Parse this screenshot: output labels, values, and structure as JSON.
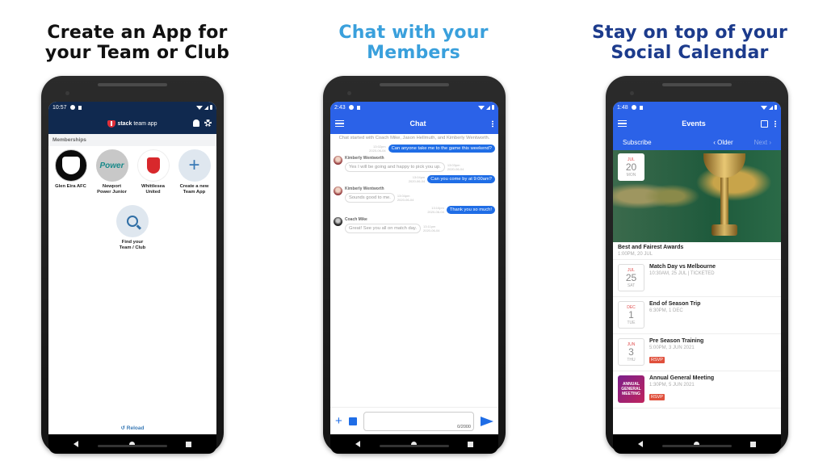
{
  "panels": [
    {
      "headline": [
        "Create an App for",
        "your Team or Club"
      ],
      "headline_color": "#111111",
      "status_time": "10:57",
      "appbar": {
        "logo_bold": "stack",
        "logo_text": "team app"
      },
      "section_title": "Memberships",
      "tiles": [
        {
          "label_lines": [
            "Glen Eira AFC"
          ]
        },
        {
          "label_lines": [
            "Newport",
            "Power Junior"
          ]
        },
        {
          "label_lines": [
            "Whittlesea",
            "United"
          ]
        },
        {
          "label_lines": [
            "Create a new",
            "Team App"
          ],
          "icon": "+"
        }
      ],
      "find_tile": {
        "label_lines": [
          "Find your",
          "Team / Club"
        ]
      },
      "reload_label": "↺ Reload",
      "colors": {
        "appbar": "#10294f",
        "accent": "#3a7ab6"
      }
    },
    {
      "headline": [
        "Chat with your",
        "Members"
      ],
      "headline_color": "#3aa0dc",
      "status_time": "2:43",
      "appbar_title": "Chat",
      "intro": "Chat started with Coach Mike, Jason Hellmuth, and Kimberly Wentworth.",
      "messages": [
        {
          "direction": "out",
          "text": "Can anyone take me to the game this weekend?",
          "time": "13:02pm",
          "date": "2020-06-04"
        },
        {
          "direction": "in",
          "sender": "Kimberly Wentworth",
          "avatar": "kimberly-avatar",
          "text": "Yes I will be going and happy to pick you up.",
          "time": "13:03pm",
          "date": "2020-06-04"
        },
        {
          "direction": "out",
          "text": "Can you come by at 9:00am?",
          "time": "13:04pm",
          "date": "2020-06-04"
        },
        {
          "direction": "in",
          "sender": "Kimberly Wentworth",
          "avatar": "kimberly-avatar",
          "text": "Sounds good to me.",
          "time": "13:04pm",
          "date": "2020-06-04"
        },
        {
          "direction": "out",
          "text": "Thank you so much!",
          "time": "13:10pm",
          "date": "2020-06-04"
        },
        {
          "direction": "in",
          "sender": "Coach Mike",
          "avatar": "coach-mike-avatar",
          "text": "Great! See you all on match day.",
          "time": "13:11pm",
          "date": "2020-06-04"
        }
      ],
      "composer": {
        "counter": "0/2000",
        "placeholder": ""
      },
      "colors": {
        "appbar": "#2b62e8",
        "bubble_out": "#1f6de6"
      }
    },
    {
      "headline": [
        "Stay on top of your",
        "Social Calendar"
      ],
      "headline_color": "#1c3b8c",
      "status_time": "1:48",
      "appbar_title": "Events",
      "subbar": {
        "subscribe": "Subscribe",
        "older": "‹  Older",
        "next": "Next  ›"
      },
      "featured": {
        "month": "JUL",
        "day": "20",
        "weekday": "MON",
        "title": "Best and Fairest Awards",
        "subtitle": "1:00PM, 20 JUL"
      },
      "events": [
        {
          "month": "JUL",
          "day": "25",
          "weekday": "SAT",
          "title": "Match Day vs Melbourne",
          "subtitle": "10:30AM, 25 JUL | TICKETED",
          "rsvp": false
        },
        {
          "month": "DEC",
          "day": "1",
          "weekday": "TUE",
          "title": "End of Season Trip",
          "subtitle": "6:30PM, 1 DEC",
          "rsvp": false
        },
        {
          "month": "JUN",
          "day": "3",
          "weekday": "THU",
          "title": "Pre Season Training",
          "subtitle": "5:00PM, 3 JUN 2021",
          "rsvp": true
        },
        {
          "thumb_text": "ANNUAL GENERAL MEETING",
          "title": "Annual General Meeting",
          "subtitle": "1:30PM, 5 JUN 2021",
          "rsvp": true
        }
      ],
      "rsvp_label": "RSVP",
      "colors": {
        "appbar": "#2b62e8",
        "rsvp": "#e0503c"
      }
    }
  ]
}
